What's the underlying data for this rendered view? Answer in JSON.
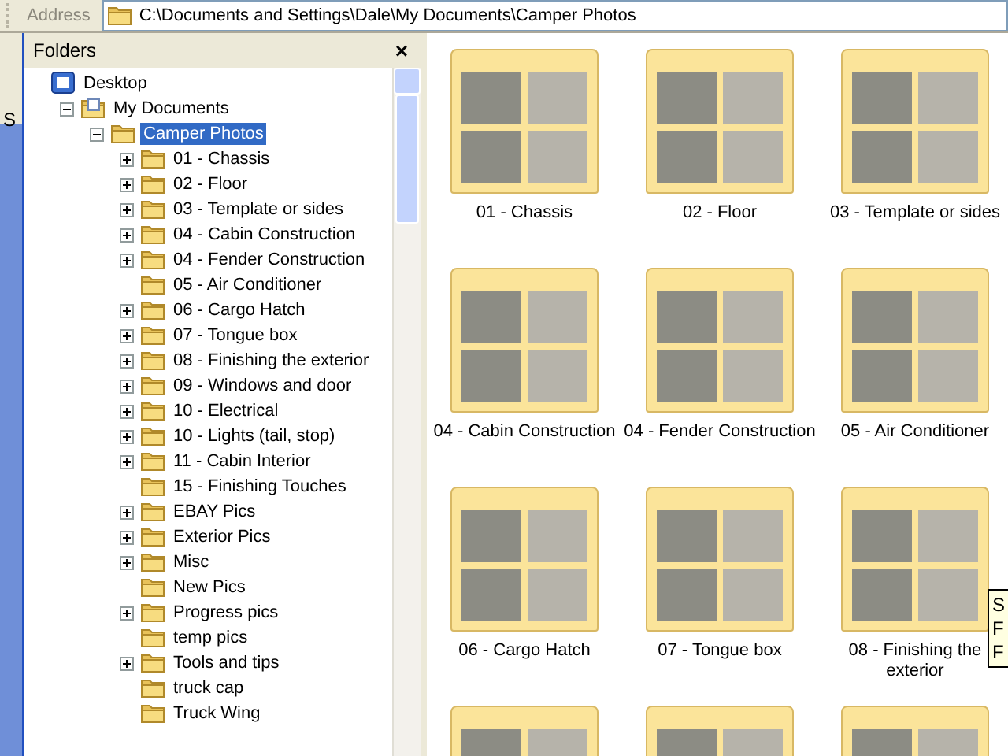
{
  "address_bar": {
    "label": "Address",
    "path": "C:\\Documents and Settings\\Dale\\My Documents\\Camper Photos"
  },
  "side_strip": {
    "text": "S"
  },
  "folders_pane": {
    "title": "Folders",
    "close": "×",
    "tree": [
      {
        "label": "Desktop",
        "kind": "desktop",
        "expandable": false,
        "selected": false,
        "children": [
          {
            "label": "My Documents",
            "kind": "documents",
            "expandable": true,
            "expanded": true,
            "selected": false,
            "children": [
              {
                "label": "Camper Photos",
                "kind": "folder",
                "expandable": true,
                "expanded": true,
                "selected": true,
                "children": [
                  {
                    "label": "01 - Chassis",
                    "kind": "folder",
                    "expandable": true,
                    "expanded": false,
                    "selected": false
                  },
                  {
                    "label": "02 - Floor",
                    "kind": "folder",
                    "expandable": true,
                    "expanded": false,
                    "selected": false
                  },
                  {
                    "label": "03 - Template or sides",
                    "kind": "folder",
                    "expandable": true,
                    "expanded": false,
                    "selected": false
                  },
                  {
                    "label": "04 - Cabin Construction",
                    "kind": "folder",
                    "expandable": true,
                    "expanded": false,
                    "selected": false
                  },
                  {
                    "label": "04 - Fender Construction",
                    "kind": "folder",
                    "expandable": true,
                    "expanded": false,
                    "selected": false
                  },
                  {
                    "label": "05 - Air Conditioner",
                    "kind": "folder",
                    "expandable": false,
                    "selected": false
                  },
                  {
                    "label": "06 - Cargo Hatch",
                    "kind": "folder",
                    "expandable": true,
                    "expanded": false,
                    "selected": false
                  },
                  {
                    "label": "07 - Tongue box",
                    "kind": "folder",
                    "expandable": true,
                    "expanded": false,
                    "selected": false
                  },
                  {
                    "label": "08 - Finishing the exterior",
                    "kind": "folder",
                    "expandable": true,
                    "expanded": false,
                    "selected": false
                  },
                  {
                    "label": "09 - Windows and door",
                    "kind": "folder",
                    "expandable": true,
                    "expanded": false,
                    "selected": false
                  },
                  {
                    "label": "10 - Electrical",
                    "kind": "folder",
                    "expandable": true,
                    "expanded": false,
                    "selected": false
                  },
                  {
                    "label": "10 - Lights (tail, stop)",
                    "kind": "folder",
                    "expandable": true,
                    "expanded": false,
                    "selected": false
                  },
                  {
                    "label": "11 - Cabin Interior",
                    "kind": "folder",
                    "expandable": true,
                    "expanded": false,
                    "selected": false
                  },
                  {
                    "label": "15 - Finishing Touches",
                    "kind": "folder",
                    "expandable": false,
                    "selected": false
                  },
                  {
                    "label": "EBAY Pics",
                    "kind": "folder",
                    "expandable": true,
                    "expanded": false,
                    "selected": false
                  },
                  {
                    "label": "Exterior Pics",
                    "kind": "folder",
                    "expandable": true,
                    "expanded": false,
                    "selected": false
                  },
                  {
                    "label": "Misc",
                    "kind": "folder",
                    "expandable": true,
                    "expanded": false,
                    "selected": false
                  },
                  {
                    "label": "New Pics",
                    "kind": "folder",
                    "expandable": false,
                    "selected": false
                  },
                  {
                    "label": "Progress pics",
                    "kind": "folder",
                    "expandable": true,
                    "expanded": false,
                    "selected": false
                  },
                  {
                    "label": "temp pics",
                    "kind": "folder",
                    "expandable": false,
                    "selected": false
                  },
                  {
                    "label": "Tools and tips",
                    "kind": "folder",
                    "expandable": true,
                    "expanded": false,
                    "selected": false
                  },
                  {
                    "label": "truck cap",
                    "kind": "folder",
                    "expandable": false,
                    "selected": false
                  },
                  {
                    "label": "Truck Wing",
                    "kind": "folder",
                    "expandable": false,
                    "selected": false
                  }
                ]
              }
            ]
          }
        ]
      }
    ]
  },
  "thumbnails": [
    {
      "kind": "folder",
      "label": "01 - Chassis"
    },
    {
      "kind": "folder",
      "label": "02 - Floor"
    },
    {
      "kind": "folder",
      "label": "03 - Template or sides"
    },
    {
      "kind": "folder",
      "label": "04 - Cabin Construction"
    },
    {
      "kind": "folder",
      "label": "04 - Fender Construction"
    },
    {
      "kind": "folder",
      "label": "05 - Air Conditioner"
    },
    {
      "kind": "folder",
      "label": "06 - Cargo Hatch"
    },
    {
      "kind": "folder",
      "label": "07 - Tongue box"
    },
    {
      "kind": "folder",
      "label": "08 - Finishing the exterior"
    },
    {
      "kind": "folder"
    },
    {
      "kind": "folder"
    },
    {
      "kind": "folder"
    }
  ],
  "tooltip": {
    "lines": [
      "S",
      "F",
      "F"
    ]
  }
}
